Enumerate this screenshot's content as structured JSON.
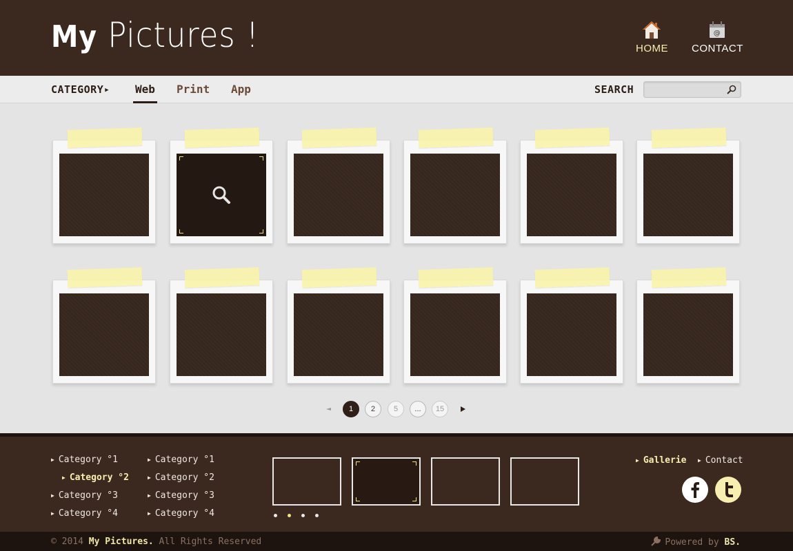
{
  "header": {
    "logo_my": "My",
    "logo_rest": " Pictures !",
    "nav": [
      {
        "label": "HOME",
        "icon": "home-icon"
      },
      {
        "label": "CONTACT",
        "icon": "contact-icon"
      }
    ]
  },
  "toolbar": {
    "category_label": "CATEGORY",
    "tabs": [
      {
        "label": "Web",
        "active": true
      },
      {
        "label": "Print",
        "active": false
      },
      {
        "label": "App",
        "active": false
      }
    ],
    "search_label": "SEARCH",
    "search_value": "",
    "search_placeholder": ""
  },
  "gallery": {
    "rows": 2,
    "cols": 6,
    "hovered_index": 1,
    "hover_icon": "zoom-icon"
  },
  "pagination": {
    "pages": [
      "1",
      "2",
      "5",
      "...",
      "15"
    ],
    "active": "1"
  },
  "footer": {
    "categories_col1": [
      "Category °1",
      "Category °2",
      "Category °3",
      "Category °4"
    ],
    "categories_col2": [
      "Category °1",
      "Category °2",
      "Category °3",
      "Category °4"
    ],
    "active_col1_index": 1,
    "slider": {
      "thumb_count": 4,
      "selected": 1,
      "dots": 4,
      "active_dot": 1
    },
    "links": [
      {
        "label": "Gallerie",
        "active": true
      },
      {
        "label": "Contact",
        "active": false
      }
    ],
    "social": [
      "facebook-icon",
      "twitter-icon"
    ]
  },
  "bottom": {
    "copyright_prefix": "© 2014 ",
    "copyright_brand": "My Pictures.",
    "copyright_suffix": " All Rights Reserved",
    "powered_prefix": "Powered by ",
    "powered_brand": "BS."
  },
  "colors": {
    "brown_dark": "#3b281e",
    "brown_darker": "#1e140f",
    "accent_yellow": "#f7efb0",
    "background": "#e4e4e4"
  }
}
